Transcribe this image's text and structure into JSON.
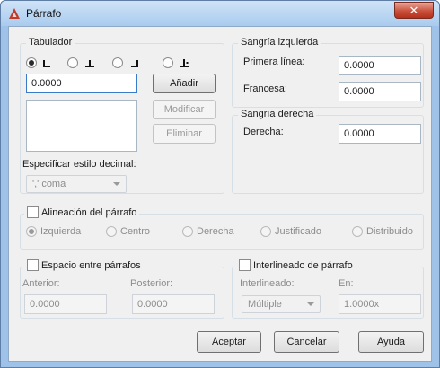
{
  "window": {
    "title": "Párrafo",
    "close_symbol": "✕",
    "icon": "autocad-icon",
    "accent": "#c0392b"
  },
  "tabulador": {
    "title": "Tabulador",
    "tab_types": [
      {
        "icon": "left-tab-icon",
        "selected": true
      },
      {
        "icon": "center-tab-icon",
        "selected": false
      },
      {
        "icon": "right-tab-icon",
        "selected": false
      },
      {
        "icon": "decimal-tab-icon",
        "selected": false
      }
    ],
    "position_value": "0.0000",
    "add_label": "Añadir",
    "modify_label": "Modificar",
    "delete_label": "Eliminar",
    "decimal_style_label": "Especificar estilo decimal:",
    "decimal_style_value": "',' coma"
  },
  "sangria_izquierda": {
    "title": "Sangría izquierda",
    "primera_label": "Primera línea:",
    "primera_value": "0.0000",
    "francesa_label": "Francesa:",
    "francesa_value": "0.0000"
  },
  "sangria_derecha": {
    "title": "Sangría derecha",
    "derecha_label": "Derecha:",
    "derecha_value": "0.0000"
  },
  "alineacion": {
    "title": "Alineación del párrafo",
    "options": [
      "Izquierda",
      "Centro",
      "Derecha",
      "Justificado",
      "Distribuido"
    ],
    "selected": "Izquierda"
  },
  "espacio": {
    "title": "Espacio entre párrafos",
    "anterior_label": "Anterior:",
    "anterior_value": "0.0000",
    "posterior_label": "Posterior:",
    "posterior_value": "0.0000"
  },
  "interlineado": {
    "title": "Interlineado de párrafo",
    "interlineado_label": "Interlineado:",
    "interlineado_value": "Múltiple",
    "en_label": "En:",
    "en_value": "1.0000x"
  },
  "buttons": {
    "accept": "Aceptar",
    "cancel": "Cancelar",
    "help": "Ayuda"
  }
}
